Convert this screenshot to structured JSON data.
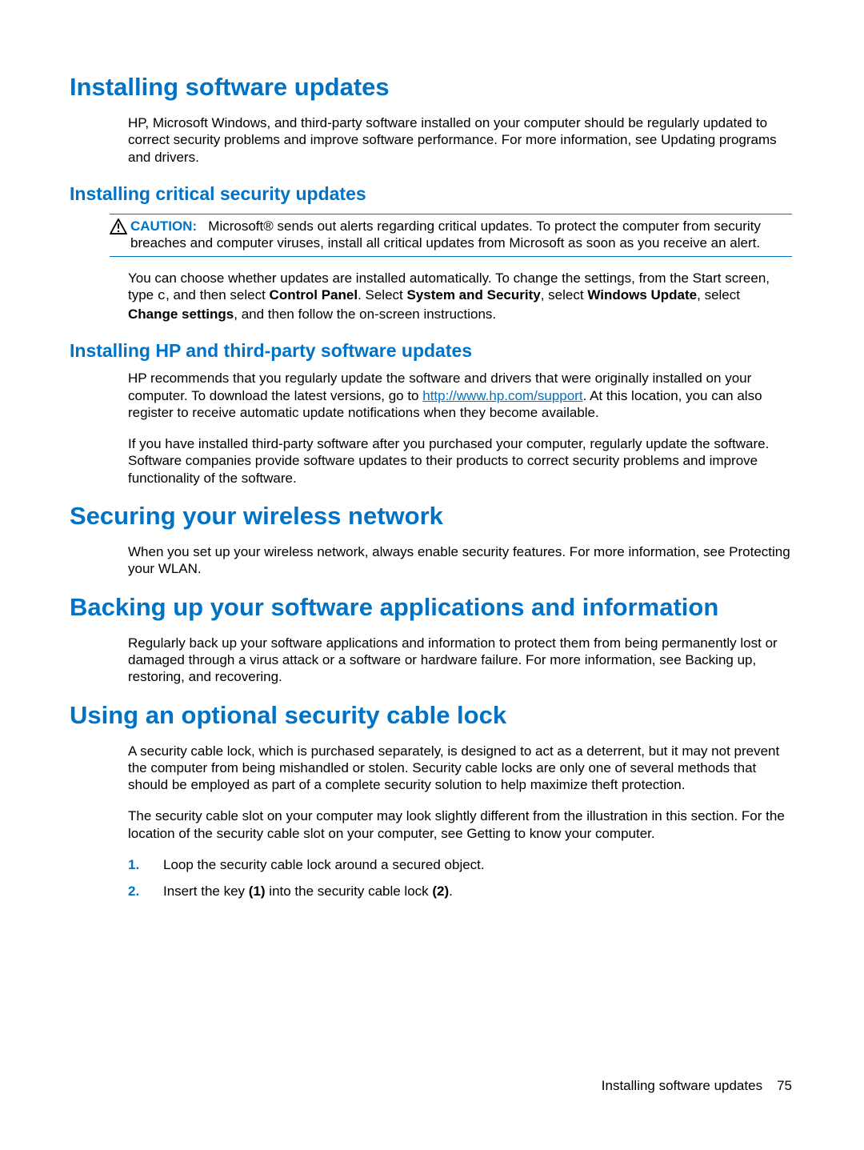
{
  "sections": {
    "installing_updates": {
      "title": "Installing software updates",
      "intro_pre": "HP, Microsoft Windows, and third-party software installed on your computer should be regularly updated to correct security problems and improve software performance. For more information, see ",
      "intro_xref": "Updating programs and drivers",
      "intro_post": "."
    },
    "critical": {
      "title": "Installing critical security updates",
      "caution_label": "CAUTION:",
      "caution_text": "Microsoft® sends out alerts regarding critical updates. To protect the computer from security breaches and computer viruses, install all critical updates from Microsoft as soon as you receive an alert.",
      "para_pre": "You can choose whether updates are installed automatically. To change the settings, from the Start screen, type ",
      "para_key": "c",
      "para_mid1": ", and then select ",
      "para_b1": "Control Panel",
      "para_mid2": ". Select ",
      "para_b2": "System and Security",
      "para_mid3": ", select ",
      "para_b3": "Windows Update",
      "para_mid4": ", select ",
      "para_b4": "Change settings",
      "para_post": ", and then follow the on-screen instructions."
    },
    "hp_third": {
      "title": "Installing HP and third-party software updates",
      "p1_pre": "HP recommends that you regularly update the software and drivers that were originally installed on your computer. To download the latest versions, go to ",
      "p1_link_text": "http://www.hp.com/support",
      "p1_link_href": "http://www.hp.com/support",
      "p1_post": ". At this location, you can also register to receive automatic update notifications when they become available.",
      "p2": "If you have installed third-party software after you purchased your computer, regularly update the software. Software companies provide software updates to their products to correct security problems and improve functionality of the software."
    },
    "wireless": {
      "title": "Securing your wireless network",
      "p_pre": "When you set up your wireless network, always enable security features. For more information, see ",
      "p_xref": "Protecting your WLAN",
      "p_post": "."
    },
    "backing_up": {
      "title": "Backing up your software applications and information",
      "p_pre": "Regularly back up your software applications and information to protect them from being permanently lost or damaged through a virus attack or a software or hardware failure. For more information, see ",
      "p_xref": "Backing up, restoring, and recovering",
      "p_post": "."
    },
    "cable_lock": {
      "title": "Using an optional security cable lock",
      "p1": "A security cable lock, which is purchased separately, is designed to act as a deterrent, but it may not prevent the computer from being mishandled or stolen. Security cable locks are only one of several methods that should be employed as part of a complete security solution to help maximize theft protection.",
      "p2_pre": "The security cable slot on your computer may look slightly different from the illustration in this section. For the location of the security cable slot on your computer, see ",
      "p2_xref": "Getting to know your computer",
      "p2_post": ".",
      "step1": "Loop the security cable lock around a secured object.",
      "step2_pre": "Insert the key ",
      "step2_b1": "(1)",
      "step2_mid": " into the security cable lock ",
      "step2_b2": "(2)",
      "step2_post": "."
    }
  },
  "footer": {
    "text": "Installing software updates",
    "pagenum": "75"
  }
}
